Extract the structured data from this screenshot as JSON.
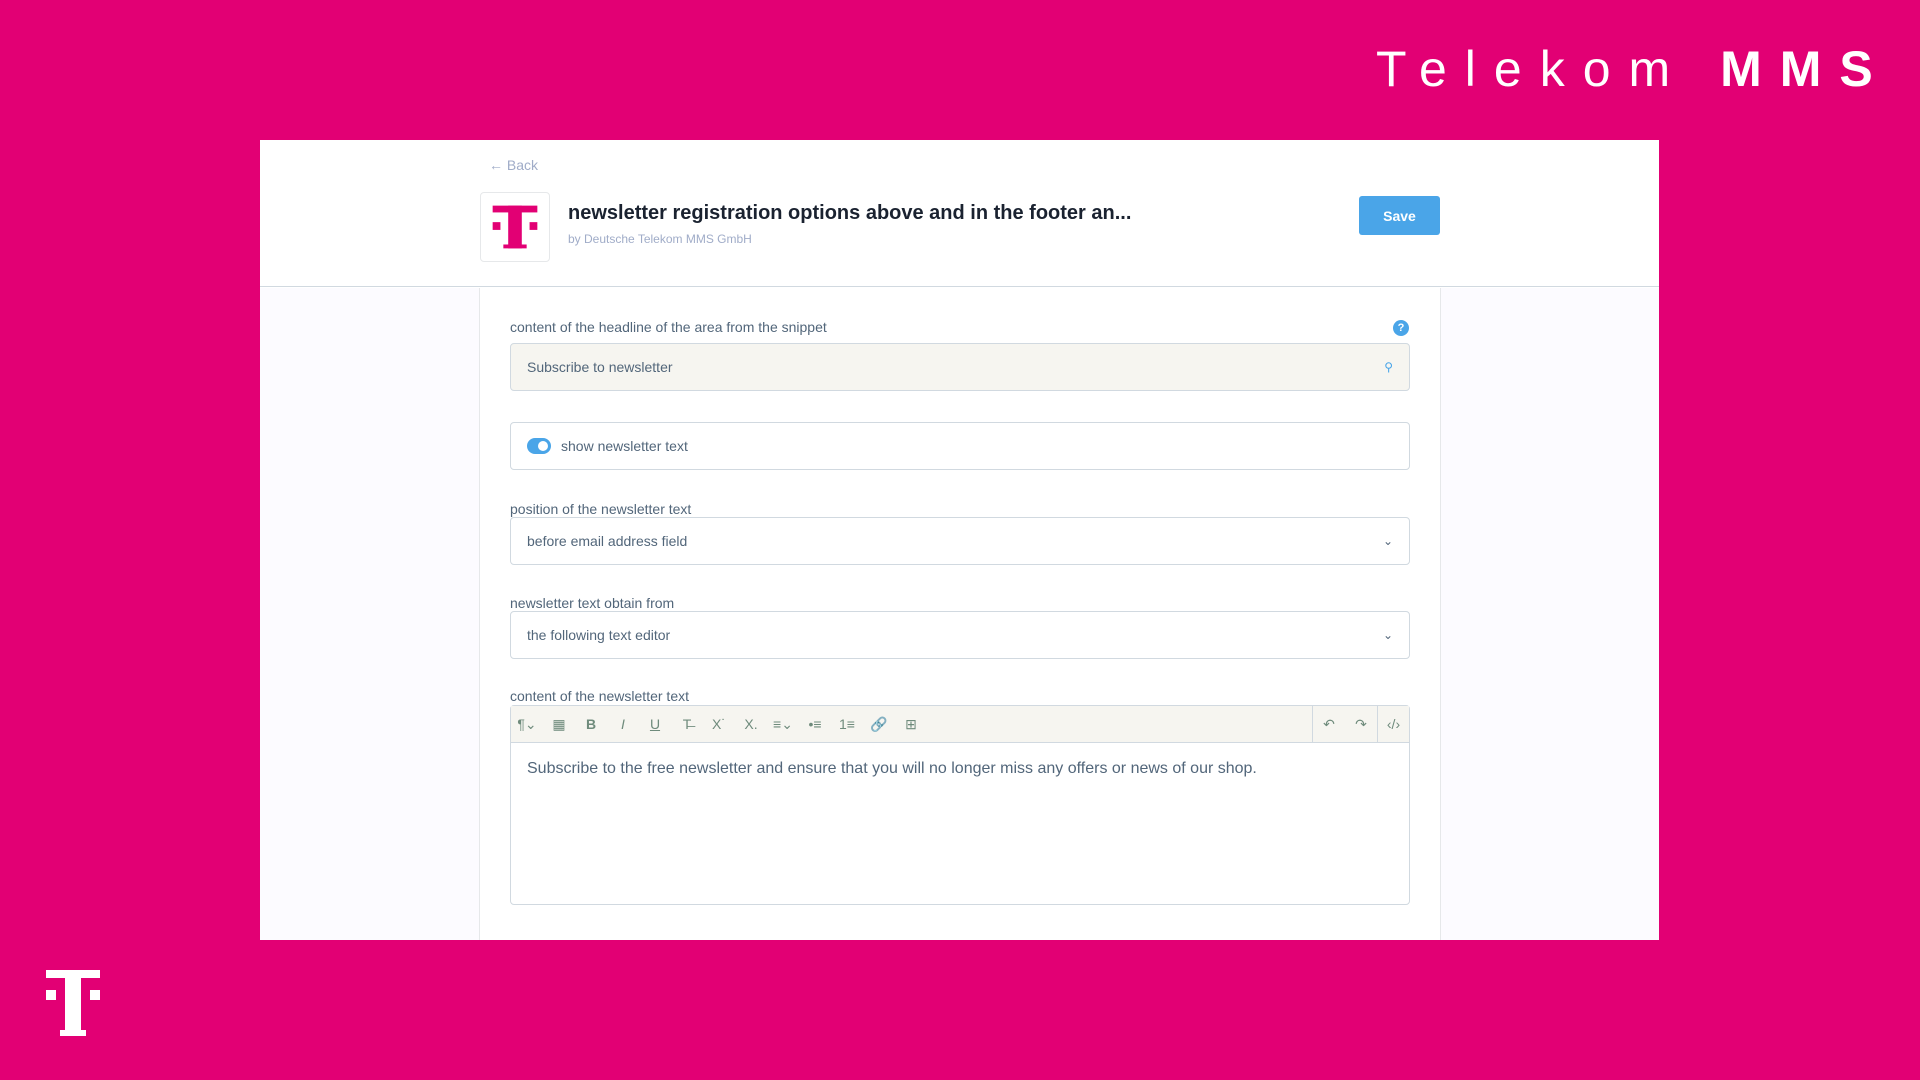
{
  "brand": {
    "word1": "Telekom",
    "word2": "MMS"
  },
  "header": {
    "back": "← Back",
    "title": "newsletter registration options above and in the footer an...",
    "subtitle": "by Deutsche Telekom MMS GmbH",
    "save": "Save"
  },
  "form": {
    "headline_label": "content of the headline of the area from the snippet",
    "headline_value": "Subscribe to newsletter",
    "help": "?",
    "toggle_label": "show newsletter text",
    "toggle_on": true,
    "position_label": "position of the newsletter text",
    "position_value": "before email address field",
    "obtain_label": "newsletter text obtain from",
    "obtain_value": "the following text editor",
    "content_label": "content of the newsletter text",
    "content_value": "Subscribe to the free newsletter and ensure that you will no longer miss any offers or news of our shop."
  },
  "toolbar": {
    "items": [
      "¶⌄",
      "▦",
      "B",
      "I",
      "U",
      "T̶",
      "X˙",
      "X.",
      "≡⌄",
      "•≡",
      "1≡",
      "🔗",
      "⊞"
    ],
    "undo": "↶",
    "redo": "↷",
    "code": "‹/›"
  },
  "colors": {
    "brand": "#e20074",
    "accent": "#4aa5e8"
  }
}
